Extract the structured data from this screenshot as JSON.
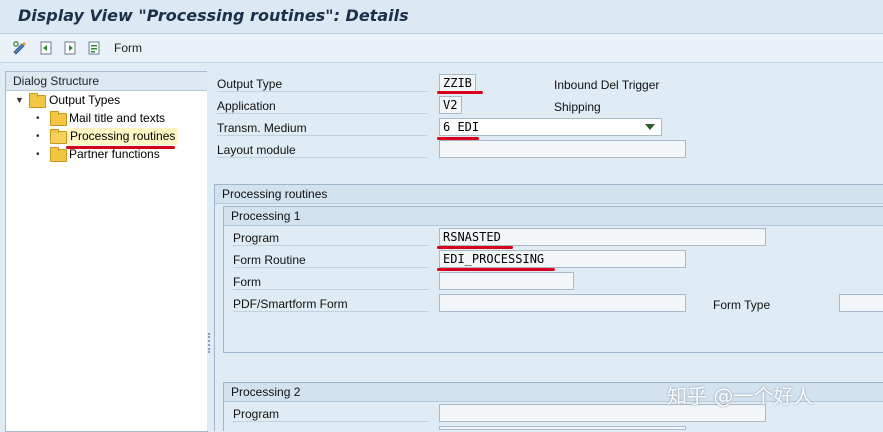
{
  "window": {
    "title": "Display View \"Processing routines\": Details"
  },
  "toolbar": {
    "form_label": "Form"
  },
  "dialog_structure": {
    "header": "Dialog Structure",
    "items": [
      {
        "label": "Output Types",
        "level": 0,
        "expanded": true,
        "selected": false
      },
      {
        "label": "Mail title and texts",
        "level": 1,
        "selected": false
      },
      {
        "label": "Processing routines",
        "level": 1,
        "selected": true
      },
      {
        "label": "Partner functions",
        "level": 1,
        "selected": false
      }
    ]
  },
  "header_fields": {
    "output_type": {
      "label": "Output Type",
      "value": "ZZIB",
      "description": "Inbound Del Trigger"
    },
    "application": {
      "label": "Application",
      "value": "V2",
      "description": "Shipping"
    },
    "transm_medium": {
      "label": "Transm. Medium",
      "value": "6 EDI"
    },
    "layout_module": {
      "label": "Layout module",
      "value": ""
    }
  },
  "processing_routines": {
    "title": "Processing routines",
    "processing1": {
      "title": "Processing 1",
      "program": {
        "label": "Program",
        "value": "RSNASTED"
      },
      "form_routine": {
        "label": "Form Routine",
        "value": "EDI_PROCESSING"
      },
      "form": {
        "label": "Form",
        "value": ""
      },
      "pdf_smartform": {
        "label": "PDF/Smartform Form",
        "value": ""
      },
      "form_type": {
        "label": "Form Type",
        "value": ""
      }
    },
    "processing2": {
      "title": "Processing 2",
      "program": {
        "label": "Program",
        "value": ""
      }
    }
  },
  "watermark": "知乎 @一个好人",
  "colors": {
    "highlight_line": "#d9001b",
    "selected_row_bg": "#fff6c4",
    "folder": "#f2c744"
  }
}
